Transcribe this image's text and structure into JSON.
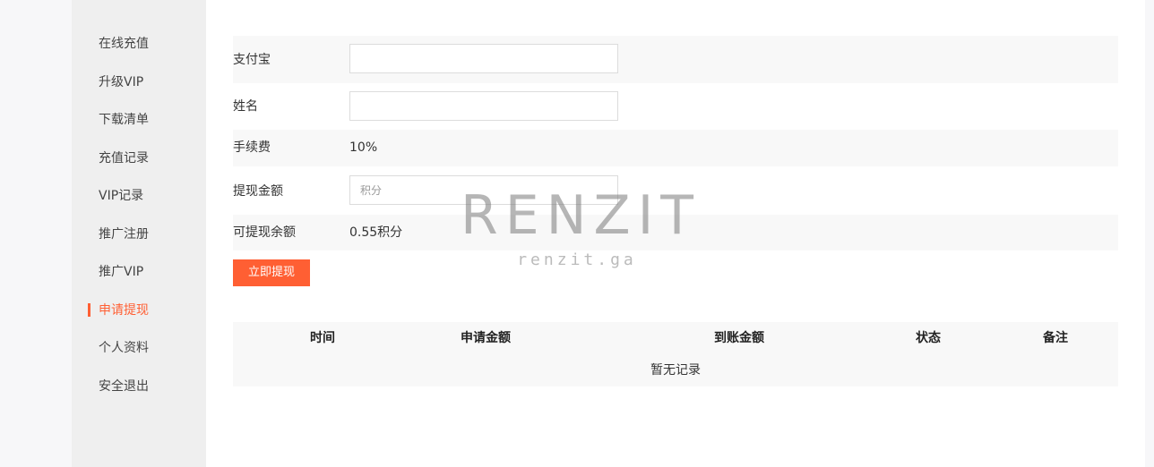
{
  "sidebar": {
    "items": [
      {
        "label": "在线充值"
      },
      {
        "label": "升级VIP"
      },
      {
        "label": "下载清单"
      },
      {
        "label": "充值记录"
      },
      {
        "label": "VIP记录"
      },
      {
        "label": "推广注册"
      },
      {
        "label": "推广VIP"
      },
      {
        "label": "申请提现",
        "active": true
      },
      {
        "label": "个人资料"
      },
      {
        "label": "安全退出"
      }
    ],
    "accent_color": "#ff5f33"
  },
  "form": {
    "alipay": {
      "label": "支付宝",
      "value": ""
    },
    "name": {
      "label": "姓名",
      "value": ""
    },
    "fee": {
      "label": "手续费",
      "value": "10%"
    },
    "amount": {
      "label": "提现金额",
      "value": "",
      "placeholder": "积分"
    },
    "balance": {
      "label": "可提现余额",
      "value": "0.55积分"
    },
    "submit_label": "立即提现"
  },
  "table": {
    "headers": [
      "时间",
      "申请金额",
      "到账金额",
      "状态",
      "备注"
    ],
    "empty_text": "暂无记录"
  },
  "watermark": {
    "big": "RENZIT",
    "small": "renzit.ga"
  }
}
